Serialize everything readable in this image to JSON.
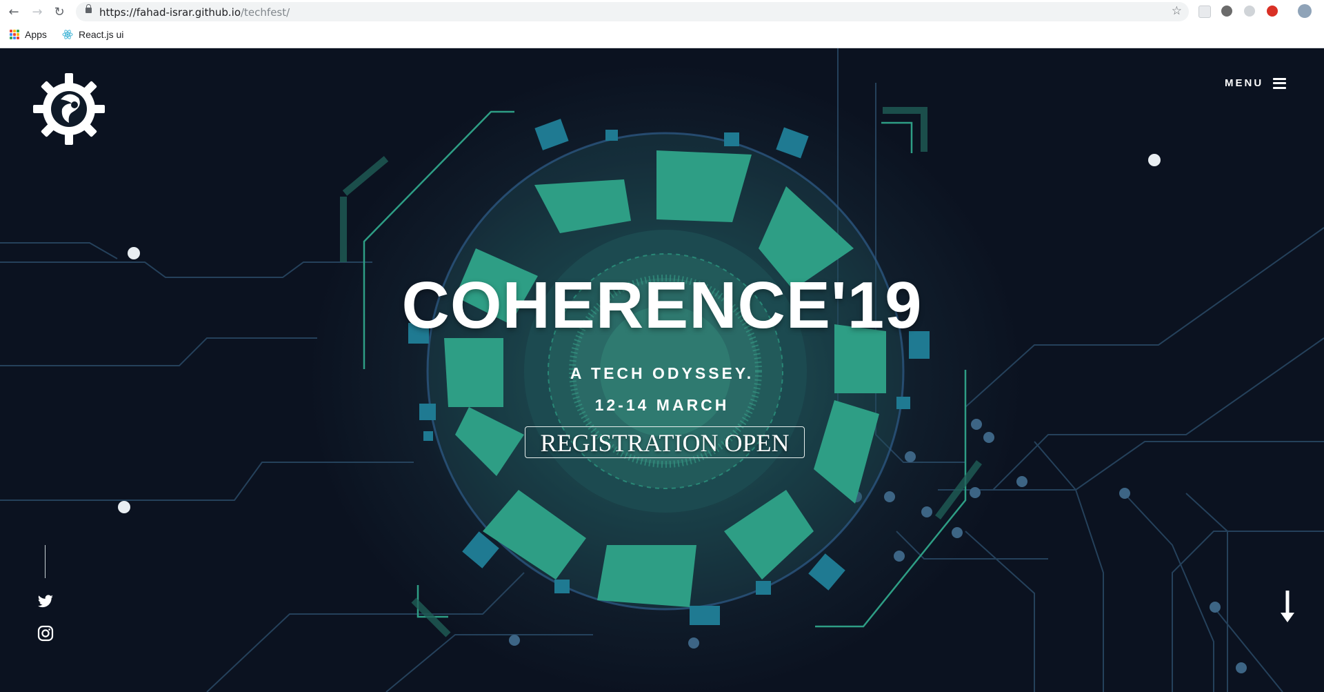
{
  "browser": {
    "url_host": "https://fahad-israr.github.io",
    "url_path": "/techfest/",
    "bookmarks": [
      {
        "label": "Apps",
        "icon": "apps-grid-icon"
      },
      {
        "label": "React.js ui",
        "icon": "react-icon"
      }
    ]
  },
  "hero": {
    "title": "COHERENCE'19",
    "subtitle": "A TECH ODYSSEY.",
    "dates": "12-14 MARCH",
    "registration": "REGISTRATION OPEN",
    "menu_label": "MENU"
  },
  "colors": {
    "accent_teal": "#2e9e85",
    "background_dark": "#0b1220",
    "circuit_line": "#2a4a66"
  }
}
